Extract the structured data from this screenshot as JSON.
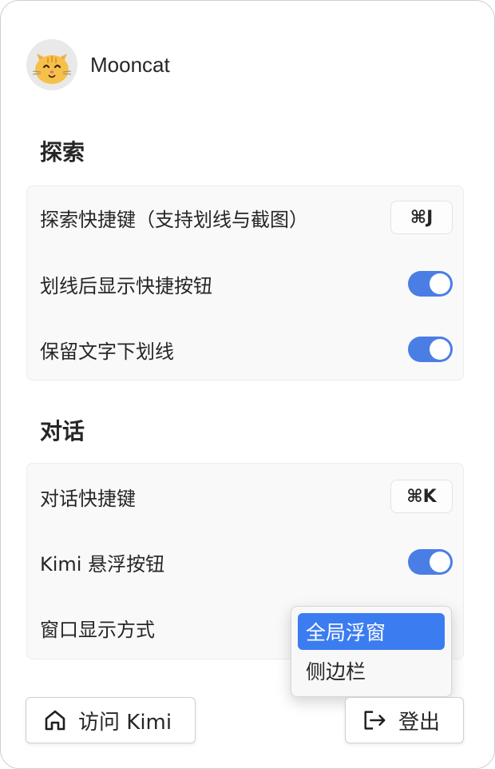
{
  "profile": {
    "username": "Mooncat",
    "avatar_icon": "cat-face-icon"
  },
  "explore": {
    "title": "探索",
    "shortcut_label": "探索快捷键（支持划线与截图）",
    "shortcut_key": "⌘J",
    "show_button_label": "划线后显示快捷按钮",
    "show_button_on": true,
    "keep_underline_label": "保留文字下划线",
    "keep_underline_on": true
  },
  "chat": {
    "title": "对话",
    "shortcut_label": "对话快捷键",
    "shortcut_key": "⌘K",
    "floating_label": "Kimi 悬浮按钮",
    "floating_on": true,
    "window_mode_label": "窗口显示方式"
  },
  "dropdown": {
    "options": [
      "全局浮窗",
      "侧边栏"
    ],
    "selected_index": 0
  },
  "footer": {
    "visit_label": "访问 Kimi",
    "visit_icon": "home-icon",
    "logout_label": "登出",
    "logout_icon": "logout-icon"
  },
  "colors": {
    "accent": "#4a7ee5",
    "selected": "#3b7cf0"
  }
}
